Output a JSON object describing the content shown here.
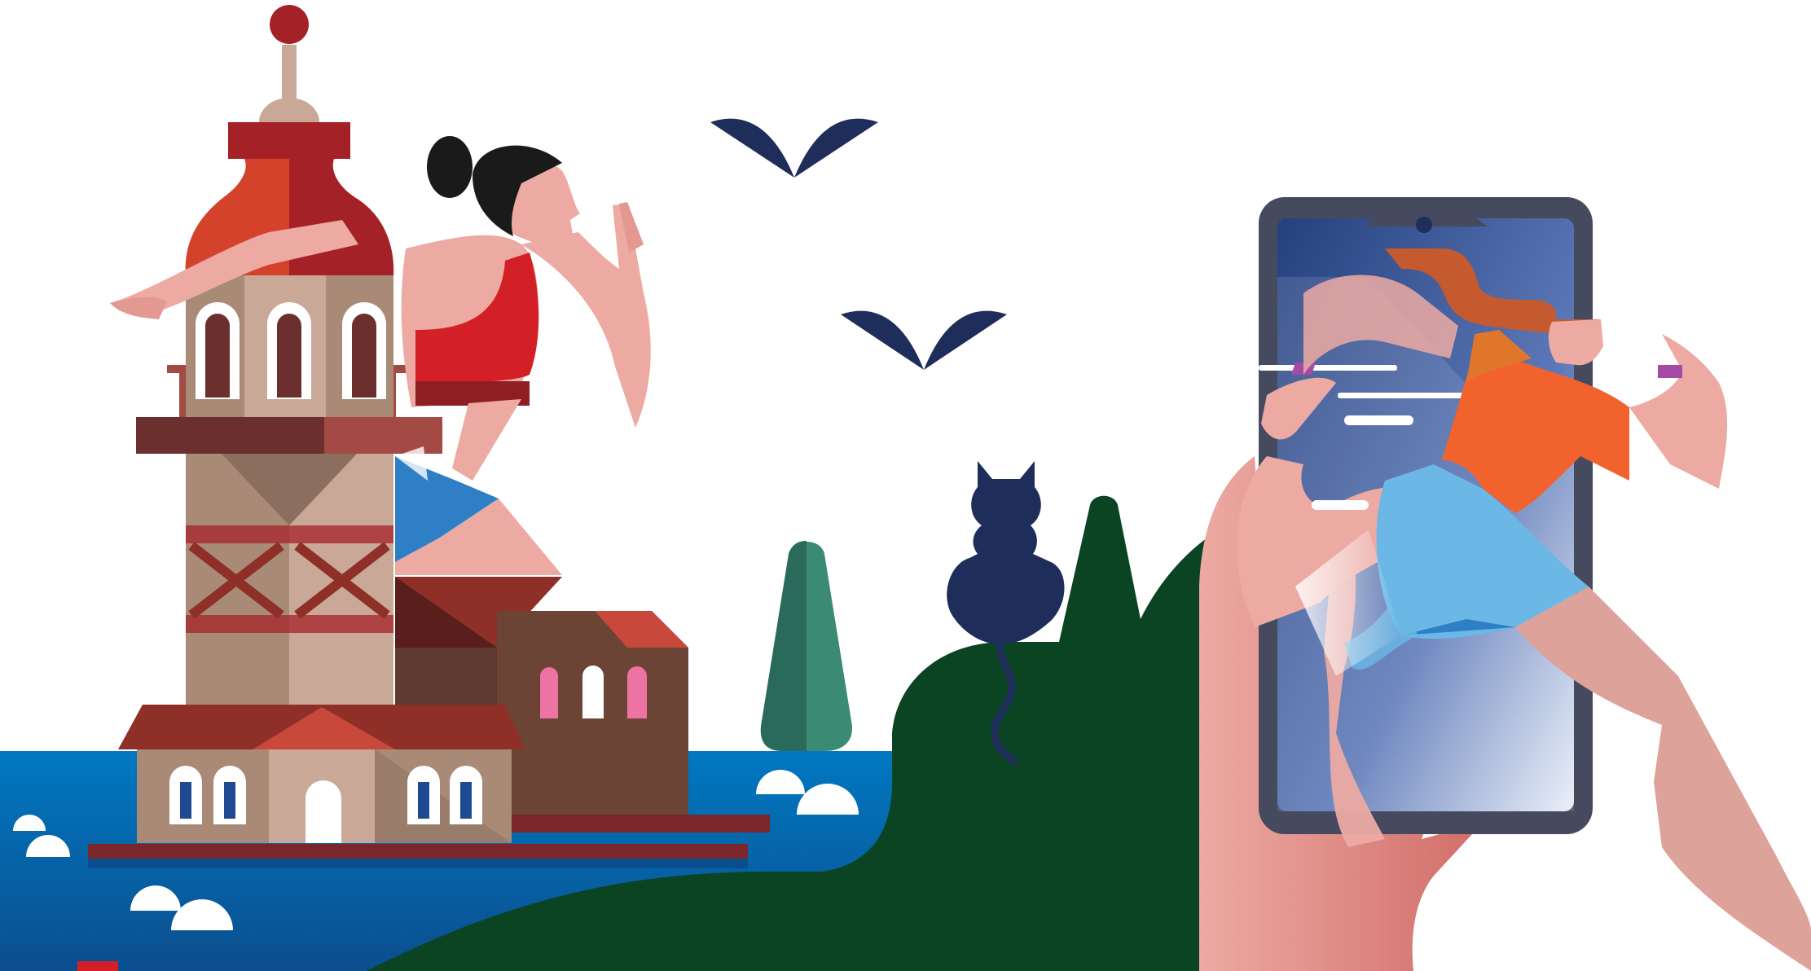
{
  "illustration": {
    "elements": [
      "maidens-tower",
      "female-runner",
      "seagull",
      "seagull",
      "cypress-tree",
      "cat-silhouette",
      "green-hill",
      "smartphone",
      "hand",
      "runner-emerging-from-phone",
      "sea",
      "clouds"
    ]
  },
  "colors": {
    "sea": "#0178C1",
    "sea_dark": "#0B4E8E",
    "hill": "#0B4422",
    "cypress": "#3A8A74",
    "cypress_dark": "#2A6A5A",
    "tower_roof": "#A52128",
    "tower_body": "#A98A77",
    "tower_light": "#C9A897",
    "tower_dark": "#6B2F2E",
    "skin": "#ECAAA3",
    "top_red": "#D32027",
    "shorts_blue": "#2E7FC6",
    "cat": "#1E2D5A",
    "bird": "#1E2D5A",
    "phone_frame": "#454A5E",
    "phone_screen": "#24407D",
    "shirt_orange": "#F2622D",
    "shorts_light_blue": "#6BB8E6",
    "cloud": "#FFFFFF"
  }
}
